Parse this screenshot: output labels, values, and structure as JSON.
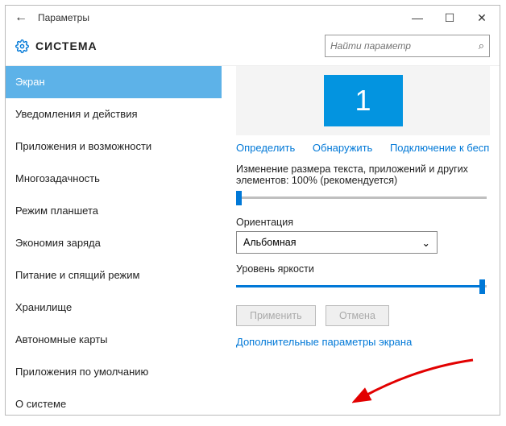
{
  "window": {
    "title": "Параметры"
  },
  "header": {
    "section": "СИСТЕМА",
    "search_placeholder": "Найти параметр"
  },
  "sidebar": {
    "items": [
      {
        "label": "Экран",
        "active": true
      },
      {
        "label": "Уведомления и действия"
      },
      {
        "label": "Приложения и возможности"
      },
      {
        "label": "Многозадачность"
      },
      {
        "label": "Режим планшета"
      },
      {
        "label": "Экономия заряда"
      },
      {
        "label": "Питание и спящий режим"
      },
      {
        "label": "Хранилище"
      },
      {
        "label": "Автономные карты"
      },
      {
        "label": "Приложения по умолчанию"
      },
      {
        "label": "О системе"
      }
    ]
  },
  "main": {
    "display_number": "1",
    "links": {
      "identify": "Определить",
      "detect": "Обнаружить",
      "wireless": "Подключение к беспроводному ди"
    },
    "scale_label": "Изменение размера текста, приложений и других элементов: 100% (рекомендуется)",
    "orientation_label": "Ориентация",
    "orientation_value": "Альбомная",
    "brightness_label": "Уровень яркости",
    "apply": "Применить",
    "cancel": "Отмена",
    "advanced_link": "Дополнительные параметры экрана"
  }
}
